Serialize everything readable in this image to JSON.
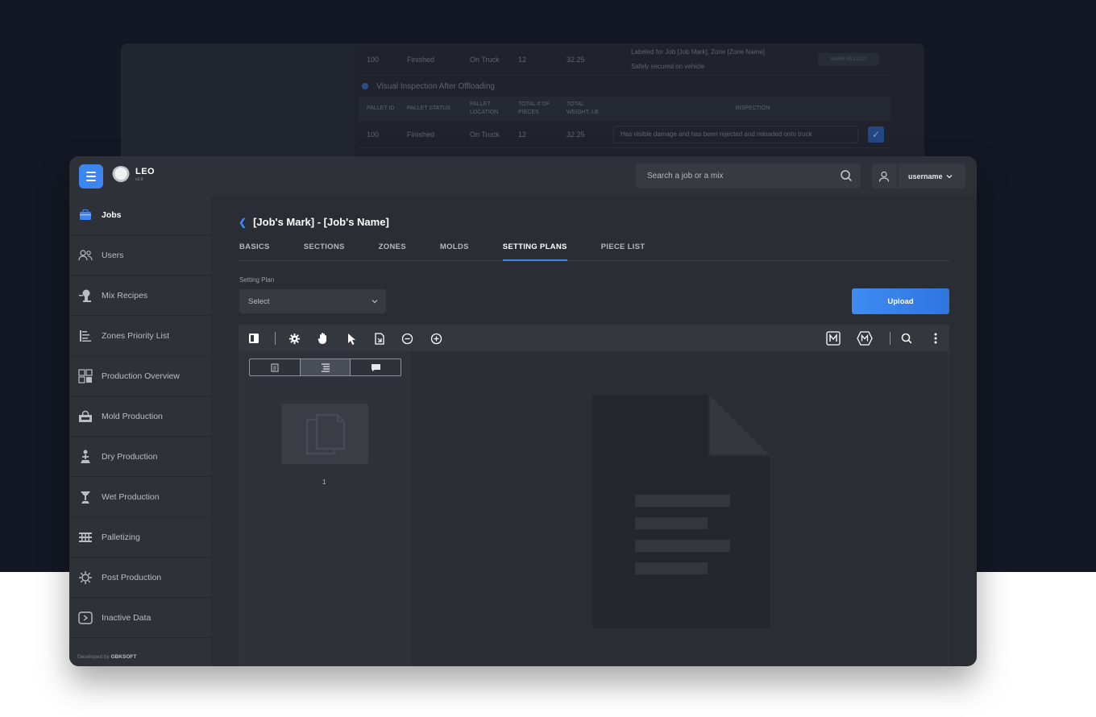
{
  "back_card": {
    "row1": [
      "100",
      "Finished",
      "On Truck",
      "12",
      "32.25"
    ],
    "row1_labels": [
      "Labeled for Job [Job Mark], Zone [Zone Name]",
      "Safely secured on vehicle"
    ],
    "row1_button": "MARK AS LOST",
    "section_title": "Visual Inspection After Offloading",
    "headers": [
      "PALLET ID",
      "PALLET STATUS",
      "PALLET LOCATION",
      "TOTAL # OF PIECES",
      "TOTAL WEIGHT, LB",
      "INSPECTION"
    ],
    "row2": [
      "100",
      "Finished",
      "On Truck",
      "12",
      "32.25"
    ],
    "row2_inspection": "Has visible damage and has been rejected and reloaded onto truck"
  },
  "app": {
    "logo_name": "LEO",
    "logo_version": "v1.0"
  },
  "header": {
    "search_placeholder": "Search a job or a mix",
    "username": "username"
  },
  "sidebar": {
    "items": [
      {
        "label": "Jobs",
        "icon": "briefcase-icon",
        "active": true
      },
      {
        "label": "Users",
        "icon": "users-icon"
      },
      {
        "label": "Mix Recipes",
        "icon": "mixer-icon"
      },
      {
        "label": "Zones Priority List",
        "icon": "priority-list-icon"
      },
      {
        "label": "Production Overview",
        "icon": "overview-icon"
      },
      {
        "label": "Mold Production",
        "icon": "mold-icon"
      },
      {
        "label": "Dry Production",
        "icon": "dry-icon"
      },
      {
        "label": "Wet Production",
        "icon": "wet-icon"
      },
      {
        "label": "Palletizing",
        "icon": "pallet-icon"
      },
      {
        "label": "Post Production",
        "icon": "post-production-icon"
      },
      {
        "label": "Inactive Data",
        "icon": "inactive-icon"
      }
    ],
    "developed_prefix": "Developed by",
    "developed_by": "GBKSOFT"
  },
  "page": {
    "title": "[Job's Mark] - [Job's Name]",
    "tabs": [
      {
        "label": "BASICS"
      },
      {
        "label": "SECTIONS"
      },
      {
        "label": "ZONES"
      },
      {
        "label": "MOLDS"
      },
      {
        "label": "SETTING PLANS",
        "active": true
      },
      {
        "label": "PIECE LIST"
      }
    ],
    "setting_plan_label": "Setting Plan",
    "select_value": "Select",
    "upload_label": "Upload"
  },
  "viewer": {
    "page_number": "1"
  },
  "colors": {
    "accent": "#3d86f0",
    "background": "#141824",
    "card": "#2a2d33",
    "sidebar": "#2e3137"
  }
}
